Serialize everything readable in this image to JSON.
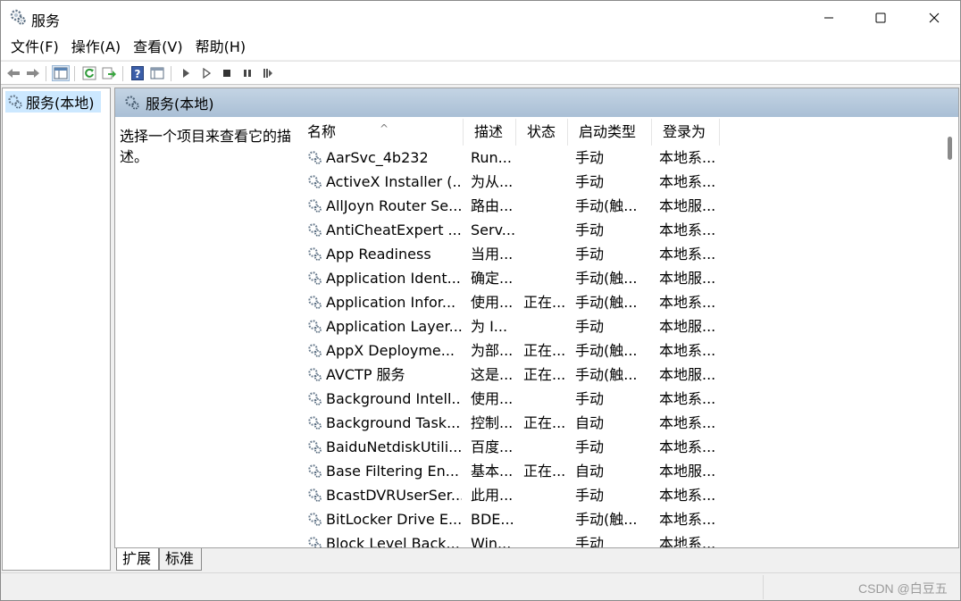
{
  "window": {
    "title": "服务",
    "controls": [
      "minimize-icon",
      "maximize-icon",
      "close-icon"
    ]
  },
  "menu": [
    {
      "label": "文件(F)"
    },
    {
      "label": "操作(A)"
    },
    {
      "label": "查看(V)"
    },
    {
      "label": "帮助(H)"
    }
  ],
  "toolbar": {
    "icons": [
      "back-arrow-icon",
      "forward-arrow-icon",
      "show-hide-tree-icon",
      "refresh-icon",
      "export-list-icon",
      "help-icon",
      "properties-icon",
      "start-service-icon",
      "start-service-alt-icon",
      "stop-service-icon",
      "pause-service-icon",
      "resume-service-icon"
    ]
  },
  "tree": {
    "selected_label": "服务(本地)"
  },
  "pane": {
    "header": "服务(本地)",
    "description": "选择一个项目来查看它的描述。"
  },
  "table": {
    "columns": [
      "名称",
      "描述",
      "状态",
      "启动类型",
      "登录为"
    ],
    "rows": [
      {
        "name": "AarSvc_4b232",
        "desc": "Run...",
        "status": "",
        "startup": "手动",
        "logon": "本地系..."
      },
      {
        "name": "ActiveX Installer (...",
        "desc": "为从...",
        "status": "",
        "startup": "手动",
        "logon": "本地系..."
      },
      {
        "name": "AllJoyn Router Se...",
        "desc": "路由...",
        "status": "",
        "startup": "手动(触...",
        "logon": "本地服..."
      },
      {
        "name": "AntiCheatExpert ...",
        "desc": "Serv...",
        "status": "",
        "startup": "手动",
        "logon": "本地系..."
      },
      {
        "name": "App Readiness",
        "desc": "当用...",
        "status": "",
        "startup": "手动",
        "logon": "本地系..."
      },
      {
        "name": "Application Ident...",
        "desc": "确定...",
        "status": "",
        "startup": "手动(触...",
        "logon": "本地服..."
      },
      {
        "name": "Application Infor...",
        "desc": "使用...",
        "status": "正在...",
        "startup": "手动(触...",
        "logon": "本地系..."
      },
      {
        "name": "Application Layer...",
        "desc": "为 I...",
        "status": "",
        "startup": "手动",
        "logon": "本地服..."
      },
      {
        "name": "AppX Deployme...",
        "desc": "为部...",
        "status": "正在...",
        "startup": "手动(触...",
        "logon": "本地系..."
      },
      {
        "name": "AVCTP 服务",
        "desc": "这是...",
        "status": "正在...",
        "startup": "手动(触...",
        "logon": "本地服..."
      },
      {
        "name": "Background Intell...",
        "desc": "使用...",
        "status": "",
        "startup": "手动",
        "logon": "本地系..."
      },
      {
        "name": "Background Task...",
        "desc": "控制...",
        "status": "正在...",
        "startup": "自动",
        "logon": "本地系..."
      },
      {
        "name": "BaiduNetdiskUtili...",
        "desc": "百度...",
        "status": "",
        "startup": "手动",
        "logon": "本地系..."
      },
      {
        "name": "Base Filtering En...",
        "desc": "基本...",
        "status": "正在...",
        "startup": "自动",
        "logon": "本地服..."
      },
      {
        "name": "BcastDVRUserSer...",
        "desc": "此用...",
        "status": "",
        "startup": "手动",
        "logon": "本地系..."
      },
      {
        "name": "BitLocker Drive E...",
        "desc": "BDE...",
        "status": "",
        "startup": "手动(触...",
        "logon": "本地系..."
      },
      {
        "name": "Block Level Back...",
        "desc": "Win...",
        "status": "",
        "startup": "手动",
        "logon": "本地系..."
      }
    ]
  },
  "tabs": [
    {
      "label": "扩展"
    },
    {
      "label": "标准"
    }
  ],
  "watermark": "CSDN @白豆五"
}
